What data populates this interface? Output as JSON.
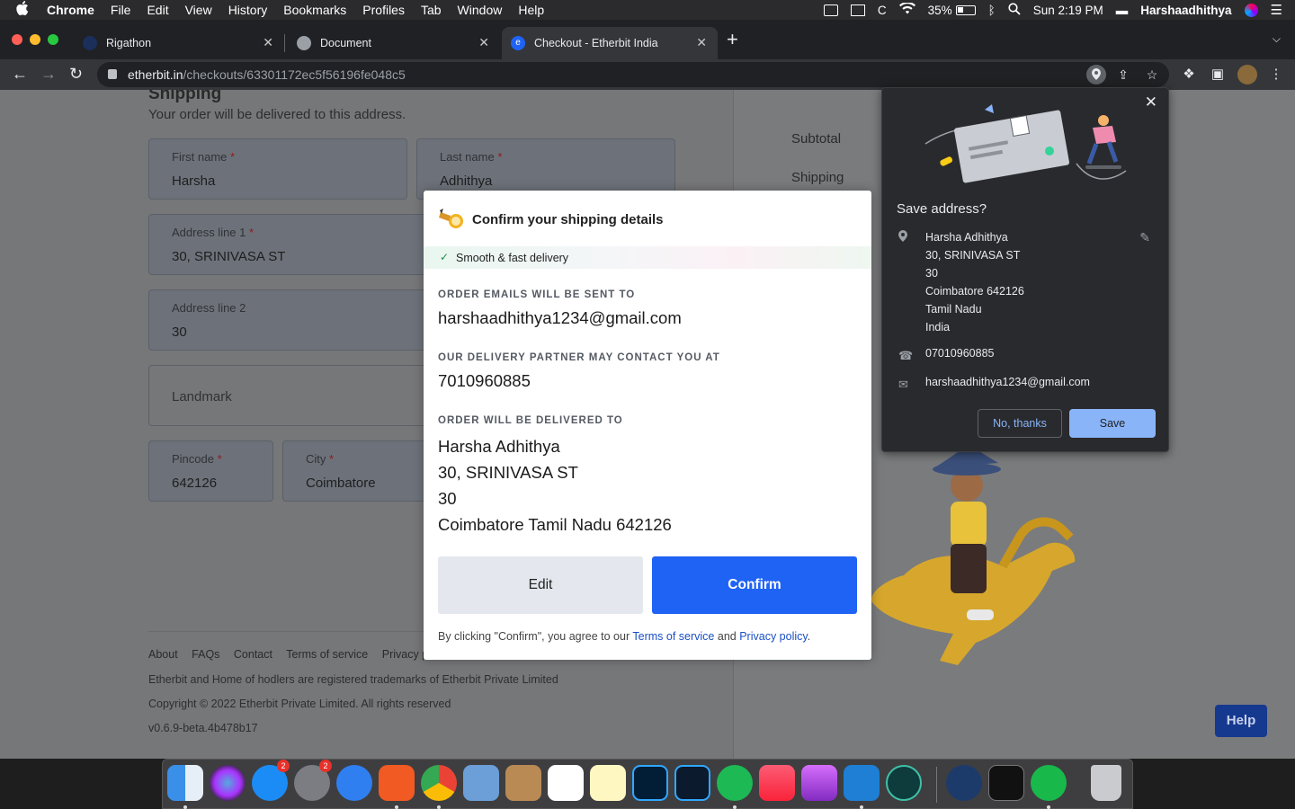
{
  "menubar": {
    "app": "Chrome",
    "items": [
      "File",
      "Edit",
      "View",
      "History",
      "Bookmarks",
      "Profiles",
      "Tab",
      "Window",
      "Help"
    ],
    "battery": "35%",
    "clock": "Sun 2:19 PM",
    "user": "Harshaadhithya"
  },
  "tabs": [
    {
      "title": "Rigathon"
    },
    {
      "title": "Document"
    },
    {
      "title": "Checkout - Etherbit India"
    }
  ],
  "address_bar": {
    "domain": "etherbit.in",
    "path": "/checkouts/63301172ec5f56196fe048c5"
  },
  "shipping": {
    "title": "Shipping",
    "subtitle": "Your order will be delivered to this address.",
    "fields": {
      "first_name": {
        "label": "First name",
        "value": "Harsha"
      },
      "last_name": {
        "label": "Last name",
        "value": "Adhithya"
      },
      "address1": {
        "label": "Address line 1",
        "value": "30, SRINIVASA ST"
      },
      "address2": {
        "label": "Address line 2",
        "value": "30"
      },
      "landmark": {
        "label": "Landmark",
        "value": ""
      },
      "pincode": {
        "label": "Pincode",
        "value": "642126"
      },
      "city": {
        "label": "City",
        "value": "Coimbatore"
      }
    },
    "required_mark": "*"
  },
  "summary": {
    "subtotal_label": "Subtotal",
    "shipping_label": "Shipping"
  },
  "footer": {
    "links": [
      "About",
      "FAQs",
      "Contact",
      "Terms of service",
      "Privacy pol"
    ],
    "trademark": "Etherbit and Home of hodlers are registered trademarks of Etherbit Private Limited",
    "copyright": "Copyright © 2022 Etherbit Private Limited. All rights reserved",
    "version": "v0.6.9-beta.4b478b17"
  },
  "help_label": "Help",
  "modal": {
    "title": "Confirm your shipping details",
    "badge": "Smooth & fast delivery",
    "email_label": "ORDER EMAILS WILL BE SENT TO",
    "email": "harshaadhithya1234@gmail.com",
    "phone_label": "OUR DELIVERY PARTNER MAY CONTACT YOU AT",
    "phone": "7010960885",
    "address_label": "ORDER WILL BE DELIVERED TO",
    "address_lines": [
      "Harsha Adhithya",
      "30, SRINIVASA ST",
      "30",
      "Coimbatore Tamil Nadu 642126"
    ],
    "edit_label": "Edit",
    "confirm_label": "Confirm",
    "terms_prefix": "By clicking \"Confirm\", you agree to our",
    "terms_link": "Terms of service",
    "terms_and": "and",
    "privacy_link": "Privacy policy",
    "terms_suffix": "."
  },
  "save_address": {
    "title": "Save address?",
    "address_lines": [
      "Harsha Adhithya",
      "30, SRINIVASA ST",
      "30",
      "Coimbatore 642126",
      "Tamil Nadu",
      "India"
    ],
    "phone": "07010960885",
    "email": "harshaadhithya1234@gmail.com",
    "no_label": "No, thanks",
    "save_label": "Save"
  },
  "colors": {
    "confirm_blue": "#1f63f5",
    "link_blue": "#1a4fc4",
    "chrome_save": "#8ab4f8"
  }
}
